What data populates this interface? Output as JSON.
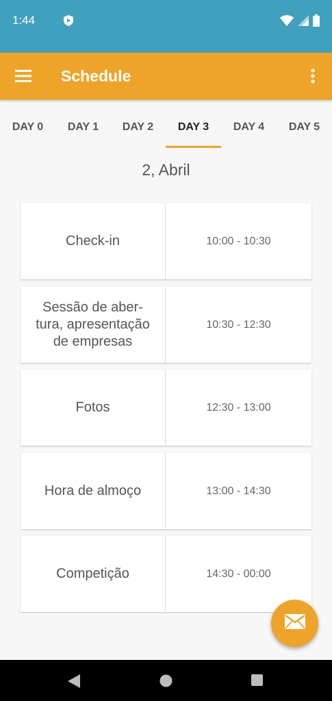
{
  "status_bar": {
    "time": "1:44"
  },
  "app_bar": {
    "title": "Schedule"
  },
  "tabs": [
    {
      "label": "DAY 0"
    },
    {
      "label": "DAY 1"
    },
    {
      "label": "DAY 2"
    },
    {
      "label": "DAY 3"
    },
    {
      "label": "DAY 4"
    },
    {
      "label": "DAY 5"
    }
  ],
  "selected_tab": "DAY 3",
  "date": "2, Abril",
  "schedule": [
    {
      "name": "Check-in",
      "time": "10:00 - 10:30"
    },
    {
      "name": "Sessão de aber-\ntura, apresentação\nde empresas",
      "time": "10:30 - 12:30"
    },
    {
      "name": "Fotos",
      "time": "12:30 - 13:00"
    },
    {
      "name": "Hora de almoço",
      "time": "13:00 - 14:30"
    },
    {
      "name": "Competição",
      "time": "14:30 - 00:00"
    }
  ],
  "colors": {
    "status_bar": "#40a0be",
    "app_bar": "#eda428",
    "accent": "#eda428"
  },
  "icons": {
    "menu": "hamburger-menu-icon",
    "more": "more-vert-icon",
    "fab": "mail-icon",
    "status": [
      "shield-icon",
      "wifi-icon",
      "signal-icon",
      "battery-icon"
    ],
    "nav": [
      "back-icon",
      "home-icon",
      "recents-icon"
    ]
  }
}
